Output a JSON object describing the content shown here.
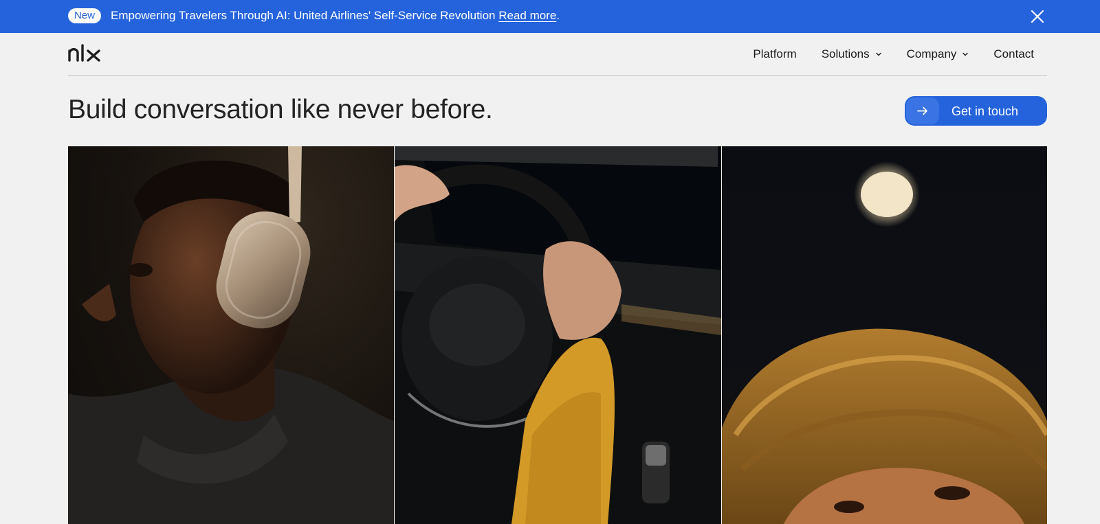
{
  "banner": {
    "badge": "New",
    "message": "Empowering Travelers Through AI: United Airlines' Self-Service Revolution ",
    "link_text": "Read more",
    "period": ".",
    "close_icon": "close-icon",
    "background_color": "#2563dc"
  },
  "header": {
    "logo_text": "nlx",
    "nav": [
      {
        "label": "Platform",
        "has_dropdown": false
      },
      {
        "label": "Solutions",
        "has_dropdown": true
      },
      {
        "label": "Company",
        "has_dropdown": true
      },
      {
        "label": "Contact",
        "has_dropdown": false
      }
    ]
  },
  "hero": {
    "title": "Build conversation like never before.",
    "cta": {
      "label": "Get in touch",
      "icon": "arrow-right-icon",
      "color": "#2563dc"
    }
  },
  "panels": [
    {
      "subject": "person-with-headphones-photo"
    },
    {
      "subject": "hands-on-steering-wheel-photo"
    },
    {
      "subject": "astronaut-helmet-under-moon-photo"
    }
  ]
}
